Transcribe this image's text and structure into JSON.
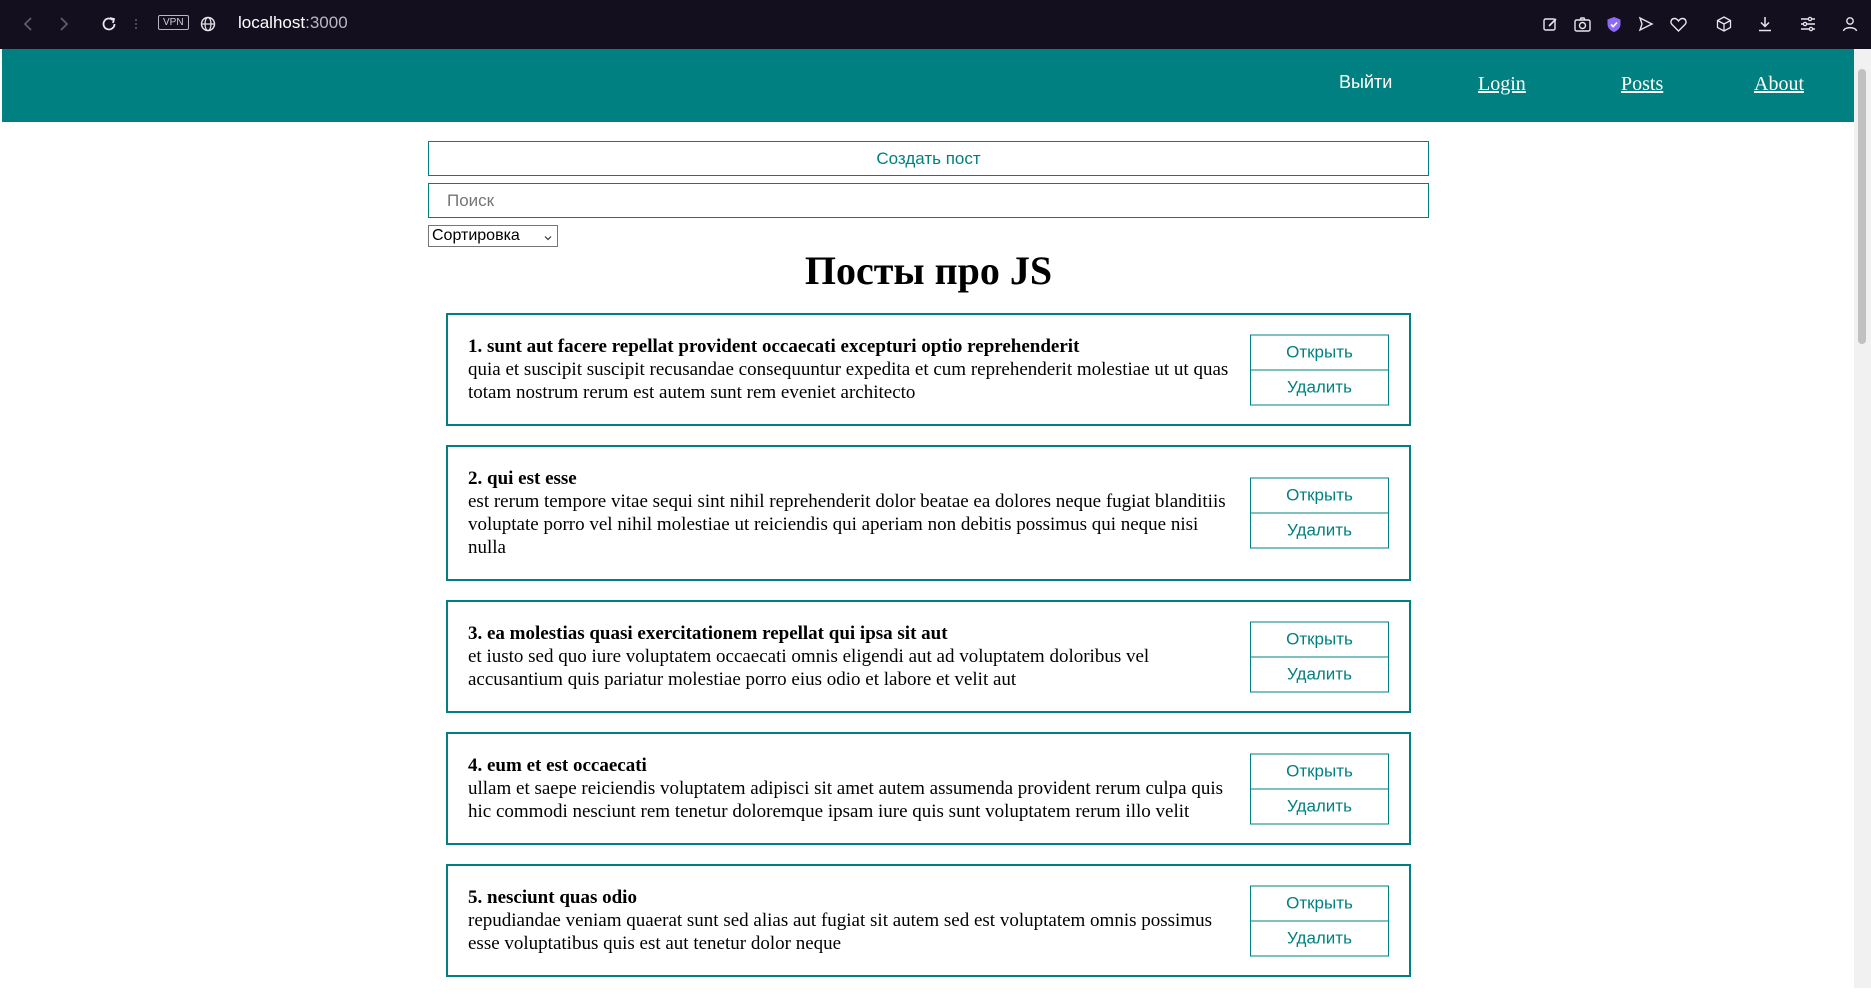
{
  "browser": {
    "host": "localhost",
    "port": ":3000",
    "vpn_label": "VPN"
  },
  "navbar": {
    "logout": "Выйти",
    "links": [
      "Login",
      "Posts",
      "About"
    ]
  },
  "main": {
    "create_button": "Создать пост",
    "search_placeholder": "Поиск",
    "sort_label": "Сортировка",
    "title": "Посты про JS",
    "open_label": "Открыть",
    "delete_label": "Удалить"
  },
  "posts": [
    {
      "title": "1. sunt aut facere repellat provident occaecati excepturi optio reprehenderit",
      "body": "quia et suscipit suscipit recusandae consequuntur expedita et cum reprehenderit molestiae ut ut quas totam nostrum rerum est autem sunt rem eveniet architecto"
    },
    {
      "title": "2. qui est esse",
      "body": "est rerum tempore vitae sequi sint nihil reprehenderit dolor beatae ea dolores neque fugiat blanditiis voluptate porro vel nihil molestiae ut reiciendis qui aperiam non debitis possimus qui neque nisi nulla"
    },
    {
      "title": "3. ea molestias quasi exercitationem repellat qui ipsa sit aut",
      "body": "et iusto sed quo iure voluptatem occaecati omnis eligendi aut ad voluptatem doloribus vel accusantium quis pariatur molestiae porro eius odio et labore et velit aut"
    },
    {
      "title": "4. eum et est occaecati",
      "body": "ullam et saepe reiciendis voluptatem adipisci sit amet autem assumenda provident rerum culpa quis hic commodi nesciunt rem tenetur doloremque ipsam iure quis sunt voluptatem rerum illo velit"
    },
    {
      "title": "5. nesciunt quas odio",
      "body": "repudiandae veniam quaerat sunt sed alias aut fugiat sit autem sed est voluptatem omnis possimus esse voluptatibus quis est aut tenetur dolor neque"
    }
  ]
}
